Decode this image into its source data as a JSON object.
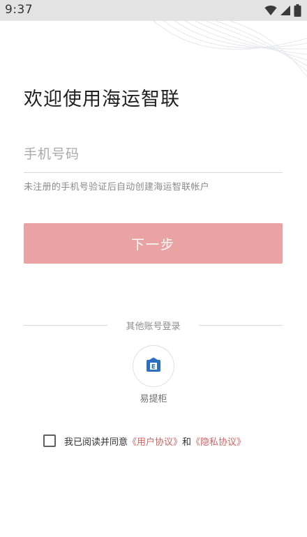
{
  "status_bar": {
    "time": "9:37"
  },
  "login": {
    "title": "欢迎使用海运智联",
    "phone_placeholder": "手机号码",
    "phone_value": "",
    "hint": "未注册的手机号验证后自动创建海运智联帐户",
    "next_button_label": "下一步",
    "next_button_color": "#e9a3a3"
  },
  "other_login": {
    "label": "其他账号登录",
    "providers": [
      {
        "name": "易提柜",
        "icon": "yitigui-icon",
        "color": "#2a6fc1"
      }
    ]
  },
  "agreement": {
    "checked": false,
    "prefix_text": "我已阅读并同意",
    "user_agreement": "《用户协议》",
    "joiner": "和",
    "privacy_policy": "《隐私协议》",
    "link_color": "#e06060"
  }
}
